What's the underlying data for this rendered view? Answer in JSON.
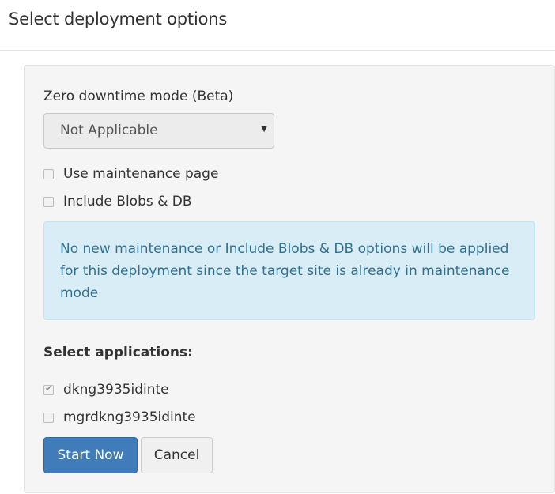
{
  "header": {
    "title": "Select deployment options"
  },
  "form": {
    "zero_downtime_label": "Zero downtime mode (Beta)",
    "zero_downtime_selected": "Not Applicable",
    "options": [
      {
        "label": "Use maintenance page",
        "checked": false
      },
      {
        "label": "Include Blobs & DB",
        "checked": false
      }
    ],
    "info_message": "No new maintenance or Include Blobs & DB options will be applied for this deployment since the target site is already in maintenance mode",
    "applications_title": "Select applications:",
    "applications": [
      {
        "label": "dkng3935idinte",
        "checked": true
      },
      {
        "label": "mgrdkng3935idinte",
        "checked": false
      }
    ]
  },
  "actions": {
    "start_label": "Start Now",
    "cancel_label": "Cancel"
  },
  "colors": {
    "primary": "#3f7cb9",
    "info_bg": "#d9edf7",
    "info_text": "#31708f",
    "panel_bg": "#f5f5f5"
  }
}
